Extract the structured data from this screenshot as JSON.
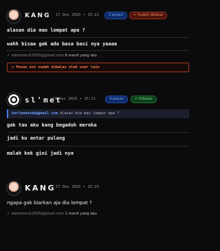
{
  "post1": {
    "username": "KANG",
    "timestamp": "17 Des 2025 • 15:21",
    "badge_pesan": "2 pesan",
    "badge_status_icon": "↩",
    "badge_status": "Sudah dibalas",
    "messages": [
      "alasan dia mau lompat apa ?",
      "wahh bisaa gak ada basa basi nya yaaaa"
    ],
    "receipt_tick": "✓",
    "receipt_email": "slametmu12505@gmail.com",
    "receipt_time": "6 menit yang lalu",
    "notice_icon": "↩",
    "notice": "Pesan ini sudah dibalas oleh user lain"
  },
  "post2": {
    "username": "sl'met",
    "timestamp": "17 Des 2025 • 15:21",
    "badge_pesan": "3 pesan",
    "badge_status_icon": "↩",
    "badge_status": "Dibalas",
    "quote_name": "herlanduswb@gmail.com",
    "quote_text": "alasan dia mau lompat apa ?",
    "messages": [
      "gak tau aku kang begaduh mereka",
      "jadi ku antar pulang",
      "malah kek gini jadi nya"
    ]
  },
  "post3": {
    "username": "KANG",
    "timestamp": "17 Des 2025 • 15:25",
    "messages": [
      "ngapa gak biarkan aja dia lompat ?"
    ],
    "receipt_tick": "✓",
    "receipt_email": "slametmu12505@gmail.com",
    "receipt_time": "1 menit yang lalu"
  },
  "colors": {
    "background": "#0b0b0d",
    "accent_blue": "#4a78f0",
    "accent_red": "#ff7a55",
    "accent_green": "#39d46a"
  }
}
